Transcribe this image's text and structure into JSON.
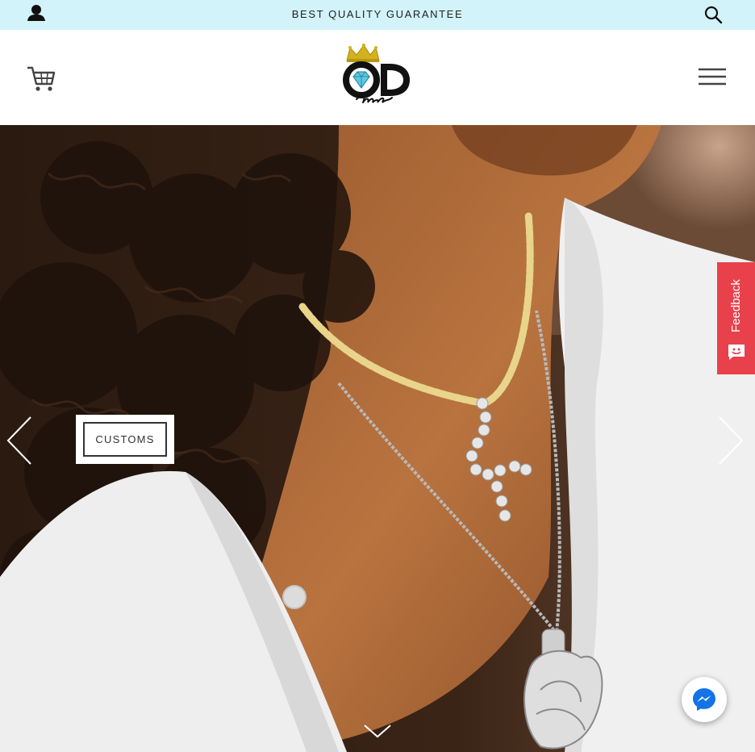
{
  "announcement": {
    "text": "BEST QUALITY GUARANTEE"
  },
  "header": {
    "account_icon": "user-icon",
    "search_icon": "search-icon",
    "cart_icon": "shopping-cart-icon",
    "menu_icon": "hamburger-menu-icon",
    "logo": {
      "letters": "OD",
      "script": "Trndz"
    }
  },
  "hero": {
    "slide_label": "CUSTOMS",
    "prev_icon": "chevron-left-icon",
    "next_icon": "chevron-right-icon",
    "scroll_icon": "chevron-down-icon"
  },
  "widgets": {
    "feedback_label": "Feedback",
    "messenger_icon": "messenger-icon"
  },
  "colors": {
    "announcement_bg": "#d2f3f9",
    "feedback_bg": "#e8414c",
    "messenger_blue": "#1473e6",
    "crown_gold": "#d4b21e",
    "diamond_blue": "#5ec8e0"
  }
}
